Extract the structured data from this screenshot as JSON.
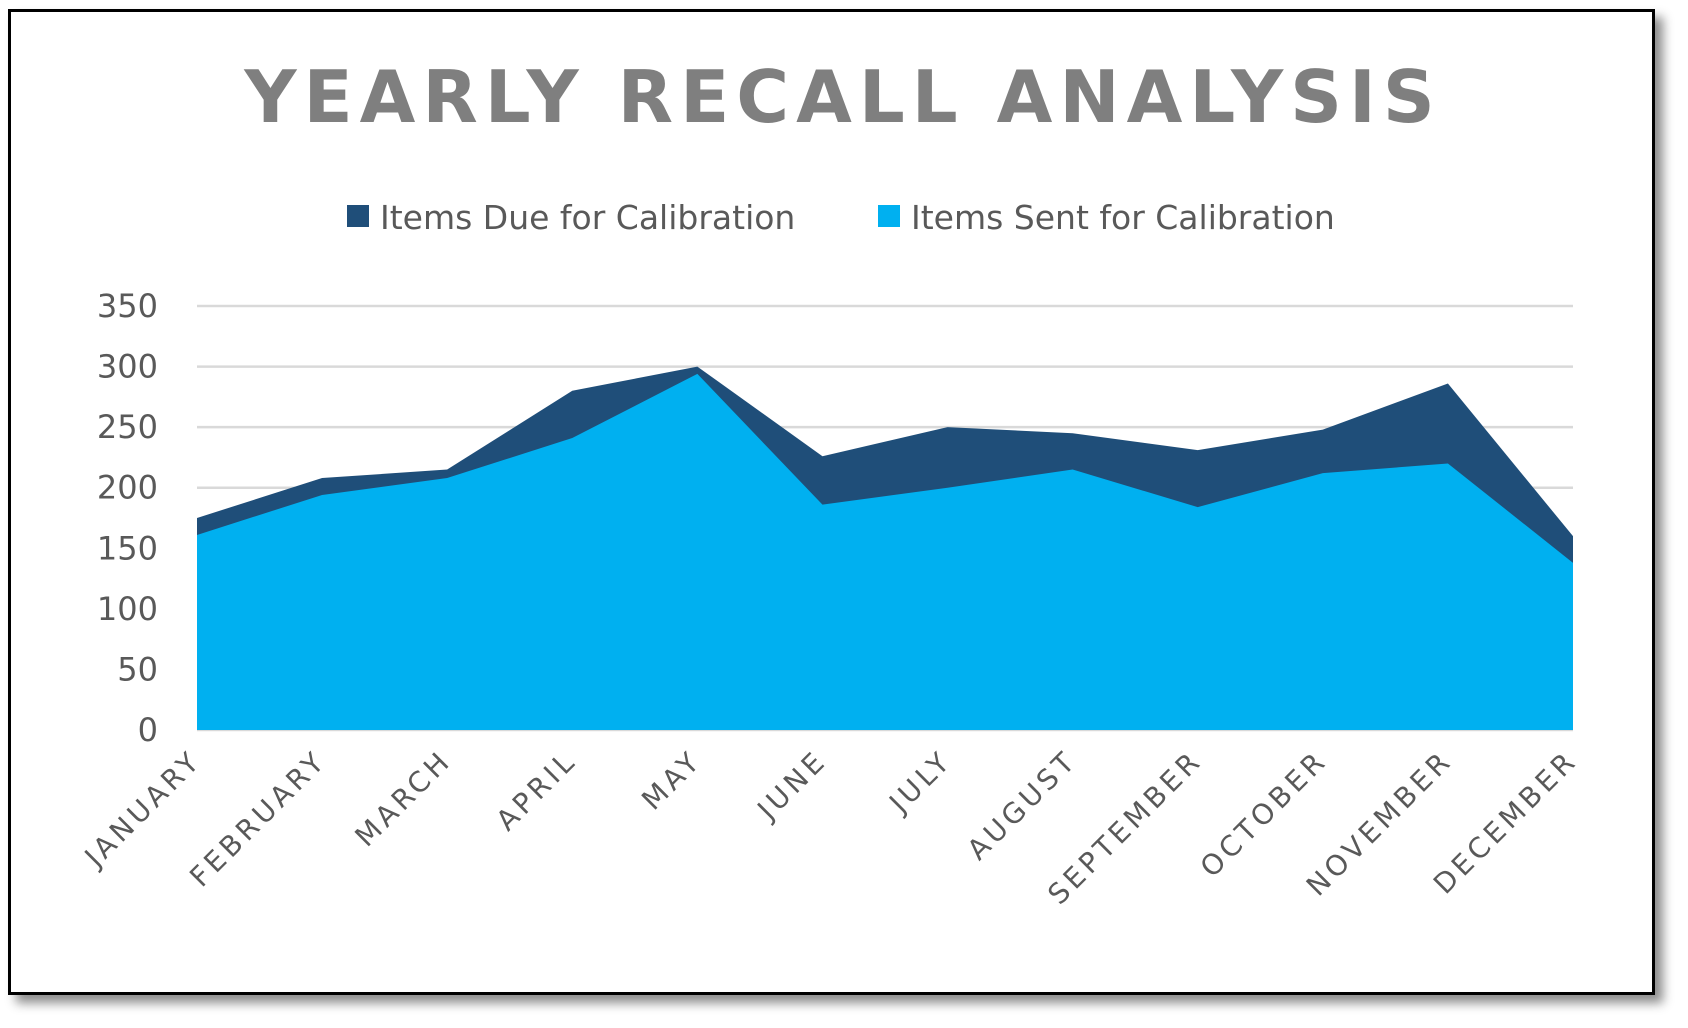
{
  "chart_data": {
    "type": "area",
    "title": "YEARLY RECALL ANALYSIS",
    "xlabel": "",
    "ylabel": "",
    "categories": [
      "JANUARY",
      "FEBRUARY",
      "MARCH",
      "APRIL",
      "MAY",
      "JUNE",
      "JULY",
      "AUGUST",
      "SEPTEMBER",
      "OCTOBER",
      "NOVEMBER",
      "DECEMBER"
    ],
    "series": [
      {
        "name": "Items Due for Calibration",
        "color": "#1F4E79",
        "values": [
          175,
          208,
          215,
          280,
          300,
          226,
          250,
          245,
          231,
          248,
          286,
          160
        ]
      },
      {
        "name": "Items Sent for Calibration",
        "color": "#00B0F0",
        "values": [
          161,
          194,
          208,
          241,
          294,
          186,
          200,
          215,
          184,
          212,
          220,
          138
        ]
      }
    ],
    "ylim": [
      0,
      350
    ],
    "yticks": [
      0,
      50,
      100,
      150,
      200,
      250,
      300,
      350
    ],
    "ytick_labels": [
      "0",
      "50",
      "100",
      "150",
      "200",
      "250",
      "300",
      "350"
    ],
    "grid": true,
    "legend_position": "top",
    "overlapping": true
  }
}
